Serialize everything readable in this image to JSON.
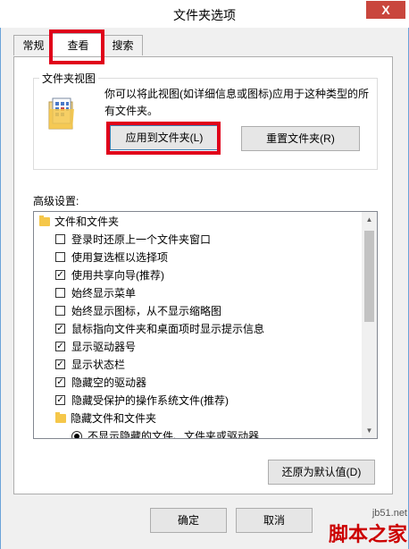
{
  "window": {
    "title": "文件夹选项",
    "close_label": "X"
  },
  "tabs": [
    {
      "label": "常规"
    },
    {
      "label": "查看"
    },
    {
      "label": "搜索"
    }
  ],
  "folder_views": {
    "title": "文件夹视图",
    "description": "你可以将此视图(如详细信息或图标)应用于这种类型的所有文件夹。",
    "apply_button": "应用到文件夹(L)",
    "reset_button": "重置文件夹(R)"
  },
  "advanced": {
    "label": "高级设置:",
    "items": [
      {
        "type": "folder",
        "text": "文件和文件夹"
      },
      {
        "type": "checkbox",
        "checked": false,
        "text": "登录时还原上一个文件夹窗口"
      },
      {
        "type": "checkbox",
        "checked": false,
        "text": "使用复选框以选择项"
      },
      {
        "type": "checkbox",
        "checked": true,
        "text": "使用共享向导(推荐)"
      },
      {
        "type": "checkbox",
        "checked": false,
        "text": "始终显示菜单"
      },
      {
        "type": "checkbox",
        "checked": false,
        "text": "始终显示图标，从不显示缩略图"
      },
      {
        "type": "checkbox",
        "checked": true,
        "text": "鼠标指向文件夹和桌面项时显示提示信息"
      },
      {
        "type": "checkbox",
        "checked": true,
        "text": "显示驱动器号"
      },
      {
        "type": "checkbox",
        "checked": true,
        "text": "显示状态栏"
      },
      {
        "type": "checkbox",
        "checked": true,
        "text": "隐藏空的驱动器"
      },
      {
        "type": "checkbox",
        "checked": true,
        "text": "隐藏受保护的操作系统文件(推荐)"
      },
      {
        "type": "folder",
        "text": "隐藏文件和文件夹"
      },
      {
        "type": "radio",
        "checked": true,
        "text": "不显示隐藏的文件、文件夹或驱动器"
      }
    ],
    "restore_button": "还原为默认值(D)"
  },
  "footer": {
    "ok_button": "确定",
    "cancel_button": "取消"
  },
  "watermark": {
    "url": "jb51.net",
    "name": "脚本之家"
  },
  "colors": {
    "highlight": "#e0001a",
    "close": "#c9463d"
  }
}
